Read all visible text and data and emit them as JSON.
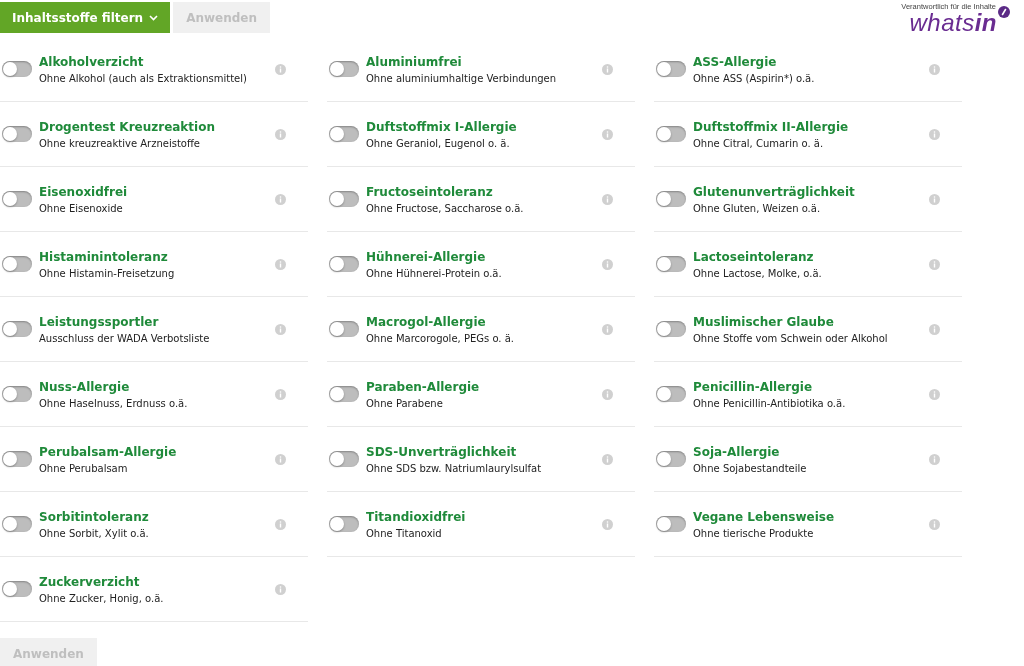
{
  "toolbar": {
    "filter_button": {
      "label": "Inhaltsstoffe filtern",
      "expanded": true
    },
    "apply_button": {
      "label": "Anwenden",
      "disabled": true
    }
  },
  "logo": {
    "caption": "Verantwortlich für die Inhalte",
    "wordmark": "whats**in**"
  },
  "filters": [
    {
      "title": "Alkoholverzicht",
      "description": "Ohne Alkohol (auch als Extraktionsmittel)",
      "on": false
    },
    {
      "title": "Aluminiumfrei",
      "description": "Ohne aluminiumhaltige Verbindungen",
      "on": false
    },
    {
      "title": "ASS-Allergie",
      "description": "Ohne ASS (Aspirin*) o.ä.",
      "on": false
    },
    {
      "title": "Drogentest Kreuzreaktion",
      "description": "Ohne kreuzreaktive Arzneistoffe",
      "on": false
    },
    {
      "title": "Duftstoffmix I-Allergie",
      "description": "Ohne Geraniol, Eugenol o. ä.",
      "on": false
    },
    {
      "title": "Duftstoffmix II-Allergie",
      "description": "Ohne Citral, Cumarin o. ä.",
      "on": false
    },
    {
      "title": "Eisenoxidfrei",
      "description": "Ohne Eisenoxide",
      "on": false
    },
    {
      "title": "Fructoseintoleranz",
      "description": "Ohne Fructose, Saccharose o.ä.",
      "on": false
    },
    {
      "title": "Glutenunverträglichkeit",
      "description": "Ohne Gluten, Weizen o.ä.",
      "on": false
    },
    {
      "title": "Histaminintoleranz",
      "description": "Ohne Histamin-Freisetzung",
      "on": false
    },
    {
      "title": "Hühnerei-Allergie",
      "description": "Ohne Hühnerei-Protein o.ä.",
      "on": false
    },
    {
      "title": "Lactoseintoleranz",
      "description": "Ohne Lactose, Molke, o.ä.",
      "on": false
    },
    {
      "title": "Leistungssportler",
      "description": "Ausschluss der WADA Verbotsliste",
      "on": false
    },
    {
      "title": "Macrogol-Allergie",
      "description": "Ohne Marcorogole, PEGs o. ä.",
      "on": false
    },
    {
      "title": "Muslimischer Glaube",
      "description": "Ohne Stoffe vom Schwein oder Alkohol",
      "on": false
    },
    {
      "title": "Nuss-Allergie",
      "description": "Ohne Haselnuss, Erdnuss o.ä.",
      "on": false
    },
    {
      "title": "Paraben-Allergie",
      "description": "Ohne Parabene",
      "on": false
    },
    {
      "title": "Penicillin-Allergie",
      "description": "Ohne Penicillin-Antibiotika o.ä.",
      "on": false
    },
    {
      "title": "Perubalsam-Allergie",
      "description": "Ohne Perubalsam",
      "on": false
    },
    {
      "title": "SDS-Unverträglichkeit",
      "description": "Ohne SDS bzw. Natriumlaurylsulfat",
      "on": false
    },
    {
      "title": "Soja-Allergie",
      "description": "Ohne Sojabestandteile",
      "on": false
    },
    {
      "title": "Sorbitintoleranz",
      "description": "Ohne Sorbit, Xylit o.ä.",
      "on": false
    },
    {
      "title": "Titandioxidfrei",
      "description": "Ohne Titanoxid",
      "on": false
    },
    {
      "title": "Vegane Lebensweise",
      "description": "Ohne tierische Produkte",
      "on": false
    },
    {
      "title": "Zuckerverzicht",
      "description": "Ohne Zucker, Honig, o.ä.",
      "on": false
    }
  ],
  "footer": {
    "apply_button": {
      "label": "Anwenden",
      "disabled": true
    }
  }
}
